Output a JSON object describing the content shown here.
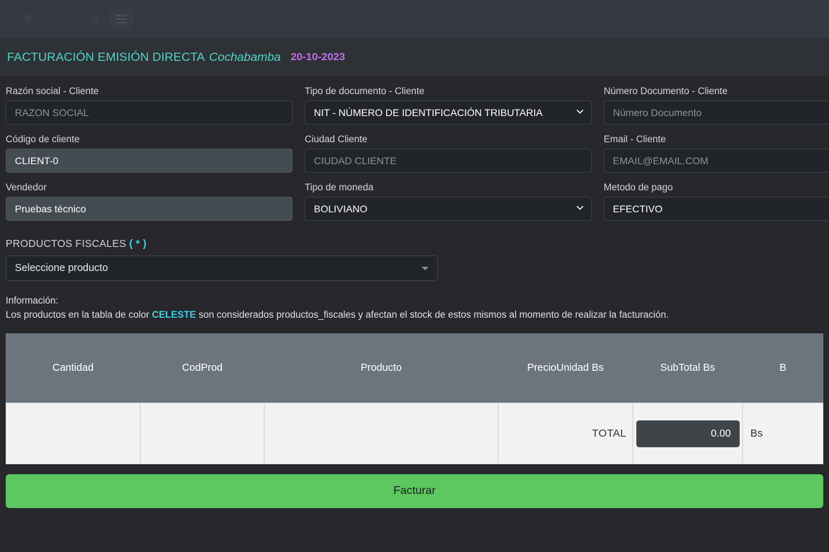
{
  "navbar": {
    "menu_icon": "hamburger-menu-icon"
  },
  "header": {
    "title": "FACTURACIÓN EMISIÓN DIRECTA",
    "city": "Cochabamba",
    "date": "20-10-2023",
    "colors": {
      "title": "#4fd4c5",
      "date": "#c06ee8"
    }
  },
  "form": {
    "razon_social": {
      "label": "Razón social - Cliente",
      "placeholder": "RAZON SOCIAL",
      "value": ""
    },
    "tipo_documento": {
      "label": "Tipo de documento - Cliente",
      "value": "NIT - NÚMERO DE IDENTIFICACIÓN TRIBUTARIA"
    },
    "numero_documento": {
      "label": "Número Documento - Cliente",
      "placeholder": "Número Documento",
      "value": ""
    },
    "codigo_cliente": {
      "label": "Código de cliente",
      "value": "CLIENT-0"
    },
    "ciudad_cliente": {
      "label": "Ciudad Cliente",
      "placeholder": "CIUDAD CLIENTE",
      "value": ""
    },
    "email_cliente": {
      "label": "Email - Cliente",
      "placeholder": "EMAIL@EMAIL.COM",
      "value": ""
    },
    "vendedor": {
      "label": "Vendedor",
      "value": "Pruebas técnico"
    },
    "tipo_moneda": {
      "label": "Tipo de moneda",
      "value": "BOLIVIANO"
    },
    "metodo_pago": {
      "label": "Metodo de pago",
      "value": "EFECTIVO"
    }
  },
  "productos_fiscales": {
    "label": "PRODUCTOS FISCALES",
    "required_mark": "( * )",
    "select_value": "Seleccione producto"
  },
  "info": {
    "heading": "Información:",
    "text_before": "Los productos en la tabla de color ",
    "highlight": "CELESTE",
    "text_after": " son considerados productos_fiscales y afectan el stock de estos mismos al momento de realizar la facturación.",
    "highlight_color": "#3fd0e0"
  },
  "table": {
    "columns": [
      "Cantidad",
      "CodProd",
      "Producto",
      "PrecioUnidad Bs",
      "SubTotal Bs",
      "B"
    ],
    "rows": [],
    "footer": {
      "total_label": "TOTAL",
      "total_value": "0.00",
      "currency": "Bs"
    }
  },
  "actions": {
    "facturar_label": "Facturar",
    "facturar_color": "#5cc85f"
  }
}
